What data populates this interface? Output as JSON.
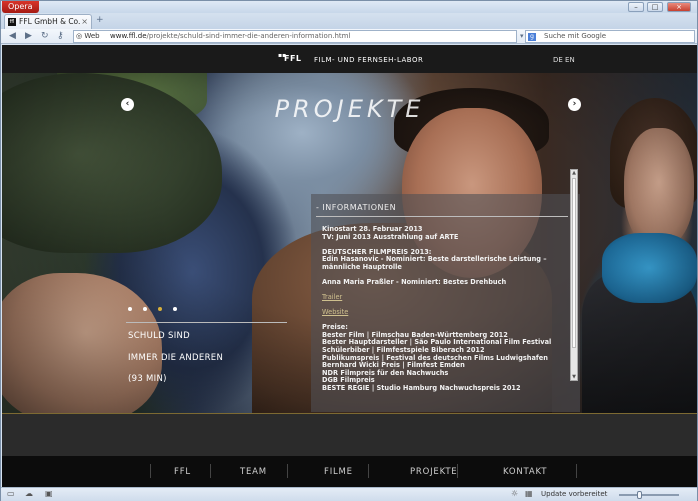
{
  "browser": {
    "menu_label": "Opera",
    "tab_title": "FFL GmbH & Co. KG: S...",
    "tab_close": "×",
    "new_tab": "+",
    "web_badge": "Web",
    "url_host": "www.ffl.de",
    "url_path": "/projekte/schuld-sind-immer-die-anderen-information.html",
    "search_placeholder": "Suche mit Google",
    "status_text": "Update vorbereitet",
    "window_buttons": {
      "minimize": "–",
      "maximize": "□",
      "close": "×"
    }
  },
  "site": {
    "logo": "FFL",
    "name": "FILM- UND FERNSEH-LABOR",
    "languages": "DE EN",
    "headline": "PROJEKTE",
    "arrow_prev": "‹",
    "arrow_next": "›",
    "film": {
      "title_line1": "SCHULD SIND",
      "title_line2": "IMMER DIE ANDEREN",
      "duration": "(93 MIN)"
    },
    "slider_dots": {
      "count": 4,
      "active_index": 3,
      "active_color": "#d8b03a"
    },
    "info": {
      "heading": "- INFORMATIONEN",
      "kinostart": "Kinostart 28. Februar 2013",
      "tv": "TV: Juni 2013 Ausstrahlung auf ARTE",
      "filmpreis_title": "DEUTSCHER FILMPREIS 2013:",
      "filmpreis_nom": "Edin Hasanovic - Nominiert: Beste darstellerische Leistung – männliche Hauptrolle",
      "drehbuch": "Anna Maria Praßler - Nominiert: Bestes Drehbuch",
      "trailer": "Trailer",
      "website": "Website",
      "preise_label": "Preise:",
      "preise": [
        "Bester Film | Filmschau Baden-Württemberg 2012",
        "Bester Hauptdarsteller | São Paulo International Film Festival",
        "Schülerbiber | Filmfestspiele Biberach 2012",
        "Publikumspreis | Festival des deutschen Films Ludwigshafen",
        "Bernhard Wicki Preis | Filmfest Emden",
        "NDR Filmpreis für den Nachwuchs",
        "DGB Filmpreis",
        "BESTE REGIE | Studio Hamburg Nachwuchspreis 2012"
      ]
    },
    "footer_nav": [
      "FFL",
      "TEAM",
      "FILME",
      "PROJEKTE",
      "KONTAKT"
    ]
  }
}
